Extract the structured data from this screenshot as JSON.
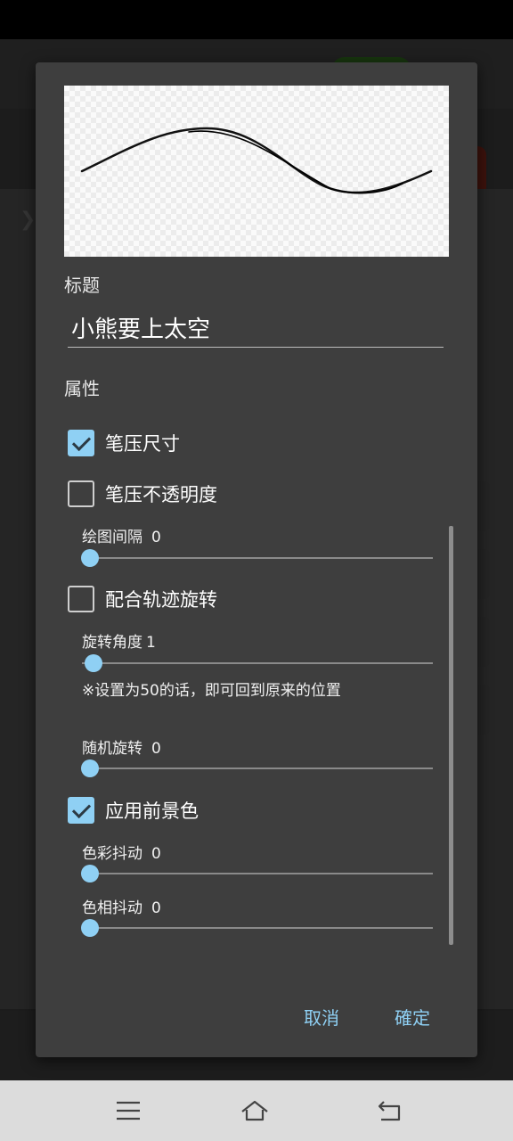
{
  "dialog": {
    "title_label": "标题",
    "title_value": "小熊要上太空",
    "properties_label": "属性",
    "checkboxes": {
      "pressure_size": {
        "label": "笔压尺寸",
        "checked": true
      },
      "pressure_opacity": {
        "label": "笔压不透明度",
        "checked": false
      },
      "follow_path_rotation": {
        "label": "配合轨迹旋转",
        "checked": false
      },
      "apply_foreground": {
        "label": "应用前景色",
        "checked": true
      }
    },
    "sliders": {
      "draw_interval": {
        "label": "绘图间隔",
        "value": "0",
        "level": 0.0
      },
      "rotation_angle": {
        "label": "旋转角度",
        "value": "1",
        "level": 0.01
      },
      "random_rotation": {
        "label": "随机旋转",
        "value": "0",
        "level": 0.0
      },
      "color_jitter": {
        "label": "色彩抖动",
        "value": "0",
        "level": 0.0
      },
      "hue_jitter": {
        "label": "色相抖动",
        "value": "0",
        "level": 0.0
      }
    },
    "rotation_note": "※设置为50的话，即可回到原来的位置",
    "buttons": {
      "cancel": "取消",
      "ok": "確定"
    }
  },
  "navbar": {
    "icons": [
      "menu-icon",
      "home-icon",
      "back-icon"
    ]
  },
  "colors": {
    "accent": "#8fd0f4",
    "dialog_bg": "#3e3e3e"
  }
}
